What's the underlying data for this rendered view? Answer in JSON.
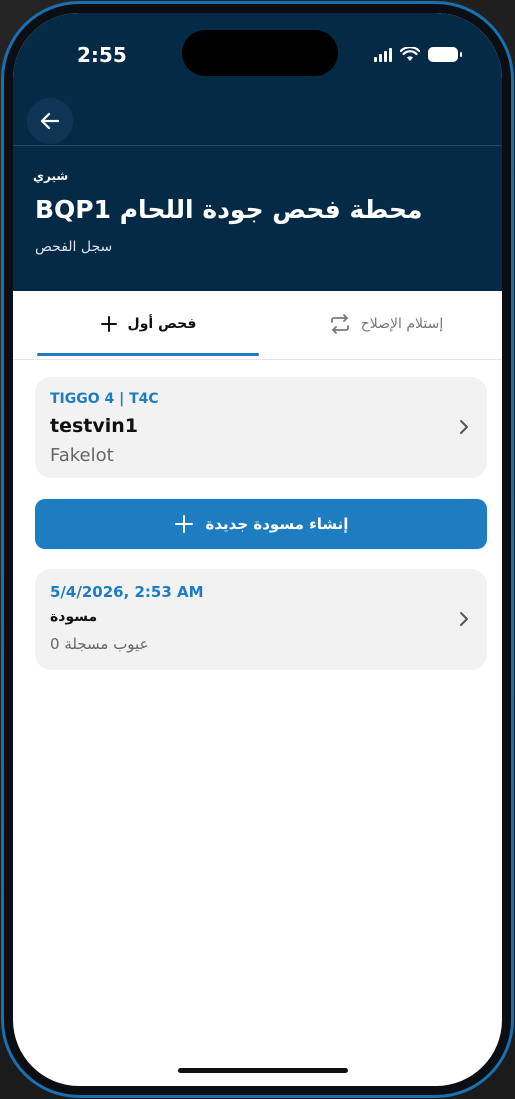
{
  "status_bar": {
    "time": "2:55"
  },
  "header": {
    "brand": "شيري",
    "title": "محطة فحص جودة اللحام BQP1",
    "subtitle": "سجل الفحص",
    "background_color": "#052a45"
  },
  "tabs": [
    {
      "label": "فحص أول",
      "icon": "plus-icon",
      "selected": true
    },
    {
      "label": "إستلام الإصلاح",
      "icon": "repeat-icon",
      "selected": false
    }
  ],
  "vehicle_card": {
    "model": "TIGGO 4 | T4C",
    "vin": "testvin1",
    "lot": "Fakelot"
  },
  "create_button": {
    "label": "إنشاء مسودة جديدة",
    "icon": "plus-icon",
    "color": "#1e7cc0"
  },
  "draft_card": {
    "date": "5/4/2026, 2:53 AM",
    "status": "مسودة",
    "defects": "عيوب مسجلة 0"
  },
  "accent_color": "#1e7cc0"
}
